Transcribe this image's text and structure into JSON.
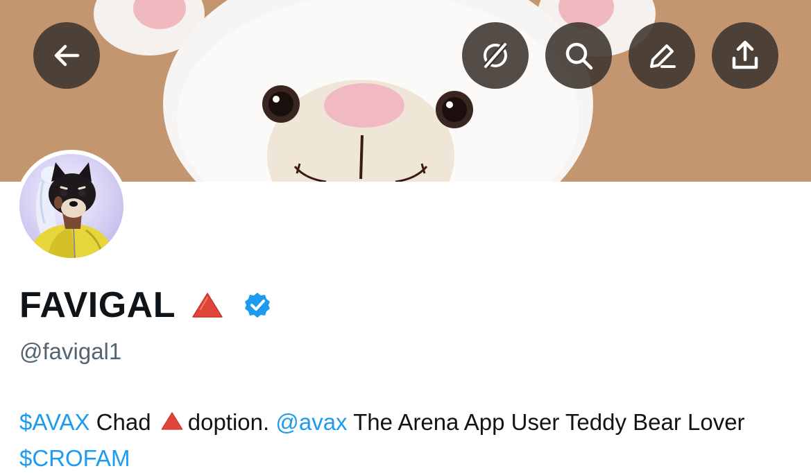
{
  "profile": {
    "display_name": "FAVIGAL",
    "handle": "@favigal1",
    "verified": true
  },
  "bio": {
    "parts": [
      {
        "text": "$AVAX",
        "type": "cashtag"
      },
      {
        "text": " Chad ",
        "type": "text"
      },
      {
        "text": "doption. ",
        "type": "text"
      },
      {
        "text": "@avax",
        "type": "mention"
      },
      {
        "text": " The Arena App User Teddy Bear Lover ",
        "type": "text"
      },
      {
        "text": "$CROFAM",
        "type": "cashtag"
      }
    ]
  },
  "nav": {
    "back": "arrow-left-icon",
    "grok": "grok-icon",
    "search": "search-icon",
    "edit": "edit-pencil-icon",
    "share": "share-upload-icon"
  },
  "colors": {
    "link": "#1d9bf0",
    "verified_badge": "#1d9bf0",
    "triangle": "#e0453a",
    "handle": "#536471",
    "text": "#0f1419",
    "nav_button_bg": "#3c342e"
  }
}
